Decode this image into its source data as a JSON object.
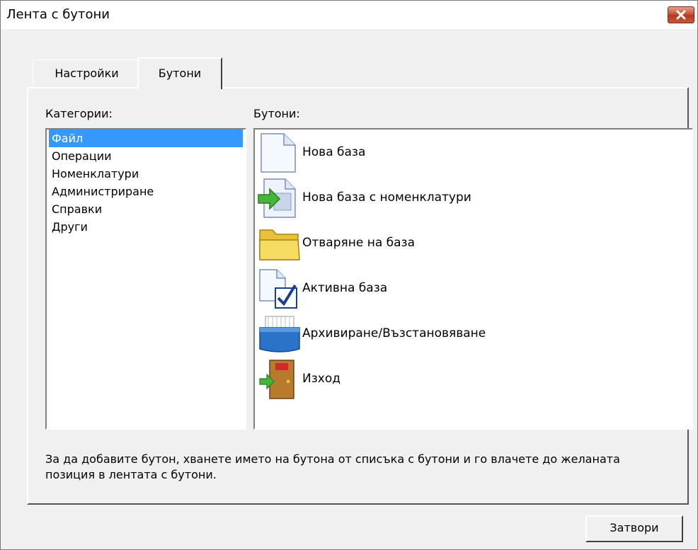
{
  "window": {
    "title": "Лента с бутони"
  },
  "tabs": [
    {
      "label": "Настройки",
      "selected": false
    },
    {
      "label": "Бутони",
      "selected": true
    }
  ],
  "categories": {
    "label": "Категории:",
    "items": [
      "Файл",
      "Операции",
      "Номенклатури",
      "Администриране",
      "Справки",
      "Други"
    ],
    "selected": "Файл"
  },
  "buttons": {
    "label": "Бутони:",
    "items": [
      {
        "label": "Нова база",
        "icon": "new-document-icon"
      },
      {
        "label": "Нова база с номенклатури",
        "icon": "new-document-arrow-icon"
      },
      {
        "label": "Отваряне на база",
        "icon": "folder-icon"
      },
      {
        "label": "Активна база",
        "icon": "document-check-icon"
      },
      {
        "label": "Архивиране/Възстановяване",
        "icon": "archive-box-icon"
      },
      {
        "label": "Изход",
        "icon": "exit-door-icon"
      }
    ]
  },
  "hint": "За да добавите бутон, хванете името на бутона от списъка с бутони и го влачете до желаната позиция в лентата с бутони.",
  "footer": {
    "close_label": "Затвори"
  },
  "colors": {
    "selection": "#3399ff",
    "close_title_button": "#c24a2d"
  }
}
